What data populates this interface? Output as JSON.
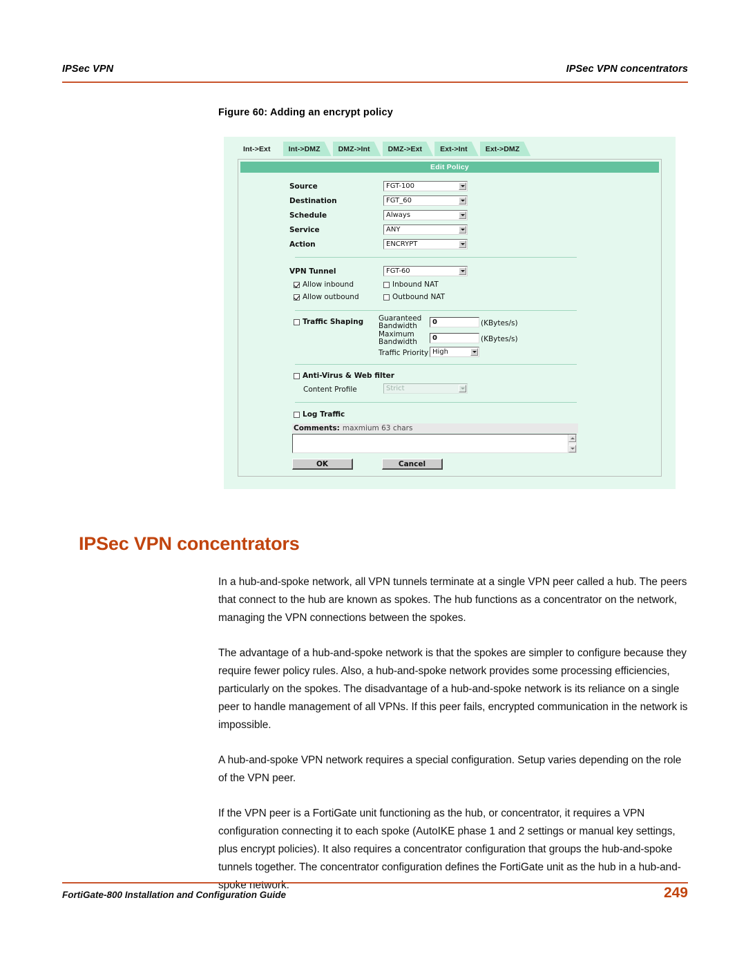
{
  "header": {
    "left": "IPSec VPN",
    "right": "IPSec VPN concentrators"
  },
  "figure": {
    "caption": "Figure 60: Adding an encrypt policy",
    "tabs": [
      {
        "label": "Int->Ext",
        "active": true
      },
      {
        "label": "Int->DMZ",
        "active": false
      },
      {
        "label": "DMZ->Int",
        "active": false
      },
      {
        "label": "DMZ->Ext",
        "active": false
      },
      {
        "label": "Ext->Int",
        "active": false
      },
      {
        "label": "Ext->DMZ",
        "active": false
      }
    ],
    "panel_title": "Edit Policy",
    "fields": {
      "source_label": "Source",
      "source_value": "FGT-100",
      "destination_label": "Destination",
      "destination_value": "FGT_60",
      "schedule_label": "Schedule",
      "schedule_value": "Always",
      "service_label": "Service",
      "service_value": "ANY",
      "action_label": "Action",
      "action_value": "ENCRYPT",
      "vpn_tunnel_label": "VPN Tunnel",
      "vpn_tunnel_value": "FGT-60",
      "allow_inbound_label": "Allow inbound",
      "allow_outbound_label": "Allow outbound",
      "inbound_nat_label": "Inbound NAT",
      "outbound_nat_label": "Outbound NAT",
      "traffic_shaping_label": "Traffic Shaping",
      "guaranteed_bandwidth_label_line1": "Guaranteed",
      "guaranteed_bandwidth_label_line2": "Bandwidth",
      "guaranteed_bandwidth_value": "0",
      "guaranteed_units": "(KBytes/s)",
      "maximum_bandwidth_label_line1": "Maximum",
      "maximum_bandwidth_label_line2": "Bandwidth",
      "maximum_bandwidth_value": "0",
      "maximum_units": "(KBytes/s)",
      "traffic_priority_label": "Traffic Priority",
      "traffic_priority_value": "High",
      "antivirus_label": "Anti-Virus & Web filter",
      "content_profile_label": "Content Profile",
      "content_profile_value": "Strict",
      "log_traffic_label": "Log Traffic",
      "comments_label": "Comments:",
      "comments_hint": "maxmium 63 chars",
      "comments_value": "",
      "ok_label": "OK",
      "cancel_label": "Cancel"
    }
  },
  "section": {
    "heading": "IPSec VPN concentrators",
    "paragraphs": [
      "In a hub-and-spoke network, all VPN tunnels terminate at a single VPN peer called a hub. The peers that connect to the hub are known as spokes. The hub functions as a concentrator on the network, managing the VPN connections between the spokes.",
      "The advantage of a hub-and-spoke network is that the spokes are simpler to configure because they require fewer policy rules. Also, a hub-and-spoke network provides some processing efficiencies, particularly on the spokes. The disadvantage of a hub-and-spoke network is its reliance on a single peer to handle management of all VPNs. If this peer fails, encrypted communication in the network is impossible.",
      "A hub-and-spoke VPN network requires a special configuration. Setup varies depending on the role of the VPN peer.",
      "If the VPN peer is a FortiGate unit functioning as the hub, or concentrator, it requires a VPN configuration connecting it to each spoke (AutoIKE phase 1 and 2 settings or manual key settings, plus encrypt policies). It also requires a concentrator configuration that groups the hub-and-spoke tunnels together. The concentrator configuration defines the FortiGate unit as the hub in a hub-and-spoke network."
    ]
  },
  "footer": {
    "guide": "FortiGate-800 Installation and Configuration Guide",
    "page_number": "249"
  },
  "colors": {
    "accent": "#c1440e",
    "rule": "#c8522a",
    "panel_title_bg": "#63c29e",
    "figure_bg": "#e4f8ee",
    "tab_inactive_bg": "#b5ead3"
  }
}
